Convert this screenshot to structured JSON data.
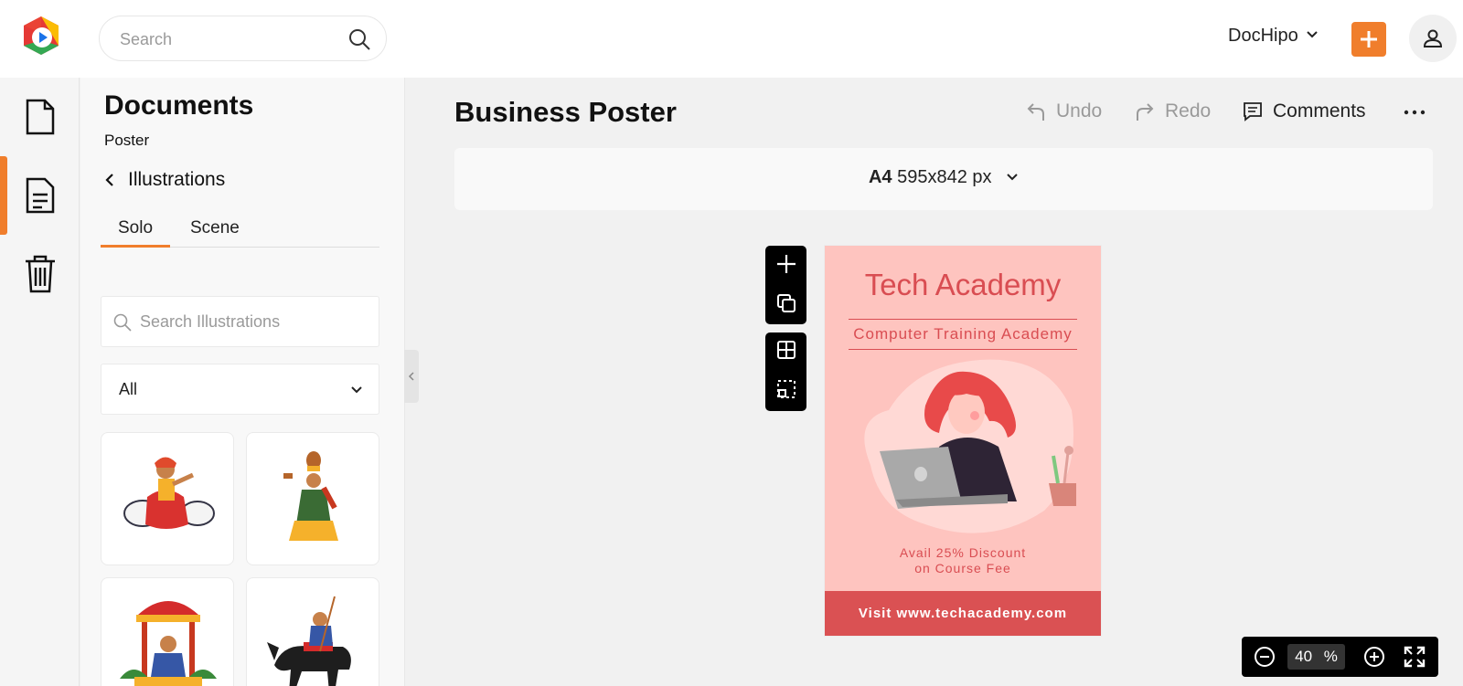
{
  "header": {
    "search_placeholder": "Search",
    "account_name": "DocHipo"
  },
  "rail": {
    "items": [
      {
        "name": "documents",
        "icon": "document-icon"
      },
      {
        "name": "templates",
        "icon": "document-lines-icon",
        "active": true
      },
      {
        "name": "trash",
        "icon": "trash-icon"
      }
    ]
  },
  "panel": {
    "title": "Documents",
    "subtitle": "Poster",
    "back_label": "Illustrations",
    "tabs": [
      {
        "label": "Solo",
        "active": true
      },
      {
        "label": "Scene",
        "active": false
      }
    ],
    "search_placeholder": "Search Illustrations",
    "filter_value": "All"
  },
  "editor": {
    "doc_title": "Business Poster",
    "undo_label": "Undo",
    "redo_label": "Redo",
    "comments_label": "Comments",
    "size_name": "A4",
    "size_dims": "595x842 px",
    "zoom_value": "40",
    "zoom_unit": "%"
  },
  "poster": {
    "title": "Tech Academy",
    "subtitle": "Computer Training Academy",
    "discount_line1": "Avail 25% Discount",
    "discount_line2": "on Course Fee",
    "footer": "Visit www.techacademy.com"
  },
  "colors": {
    "accent": "#f07e2c",
    "poster_bg": "#fec4bf",
    "poster_red": "#d94d52"
  }
}
